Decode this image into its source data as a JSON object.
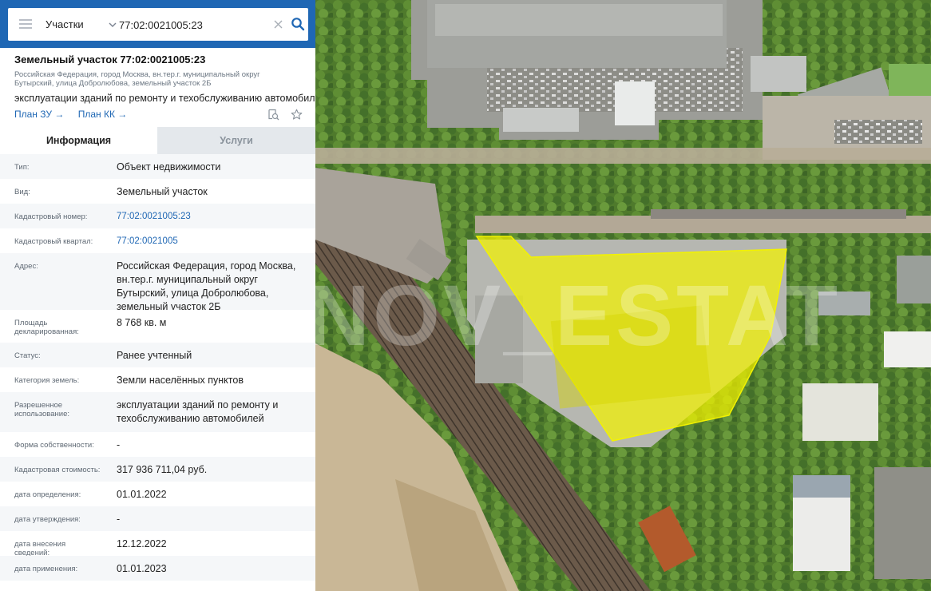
{
  "search": {
    "layer_label": "Участки",
    "query": "77:02:0021005:23"
  },
  "object": {
    "title": "Земельный участок 77:02:0021005:23",
    "address_short": "Российская Федерация, город Москва, вн.тер.г. муниципальный округ Бутырский, улица Добролюбова, земельный участок 2Б",
    "usage_line": "эксплуатации зданий по ремонту и техобслуживанию автомобилей",
    "link_plan_zu": "План ЗУ →",
    "link_plan_kk": "План КК →"
  },
  "tabs": {
    "info": "Информация",
    "services": "Услуги"
  },
  "rows": [
    {
      "key": "Тип:",
      "value": "Объект недвижимости"
    },
    {
      "key": "Вид:",
      "value": "Земельный участок"
    },
    {
      "key": "Кадастровый номер:",
      "value": "77:02:0021005:23"
    },
    {
      "key": "Кадастровый квартал:",
      "value": "77:02:0021005"
    },
    {
      "key": "Адрес:",
      "value": "Российская Федерация, город Москва, вн.тер.г. муниципальный округ Бутырский, улица Добролюбова, земельный участок 2Б"
    },
    {
      "key": "Площадь декларированная:",
      "value": "8 768 кв. м"
    },
    {
      "key": "Статус:",
      "value": "Ранее учтенный"
    },
    {
      "key": "Категория земель:",
      "value": "Земли населённых пунктов"
    },
    {
      "key": "Разрешенное использование:",
      "value": "эксплуатации зданий по ремонту и техобслуживанию автомобилей"
    },
    {
      "key": "Форма собственности:",
      "value": "-"
    },
    {
      "key": "Кадастровая стоимость:",
      "value": "317 936 711,04 руб."
    },
    {
      "key": "дата определения:",
      "value": "01.01.2022"
    },
    {
      "key": "дата утверждения:",
      "value": "-"
    },
    {
      "key": "дата внесения сведений:",
      "value": "12.12.2022"
    },
    {
      "key": "дата применения:",
      "value": "01.01.2023"
    }
  ],
  "map": {
    "watermark": "NOV_ESTAT",
    "parcel_color": "#f2f200"
  },
  "colors": {
    "brand": "#1f67b4",
    "link": "#1f67b4"
  }
}
